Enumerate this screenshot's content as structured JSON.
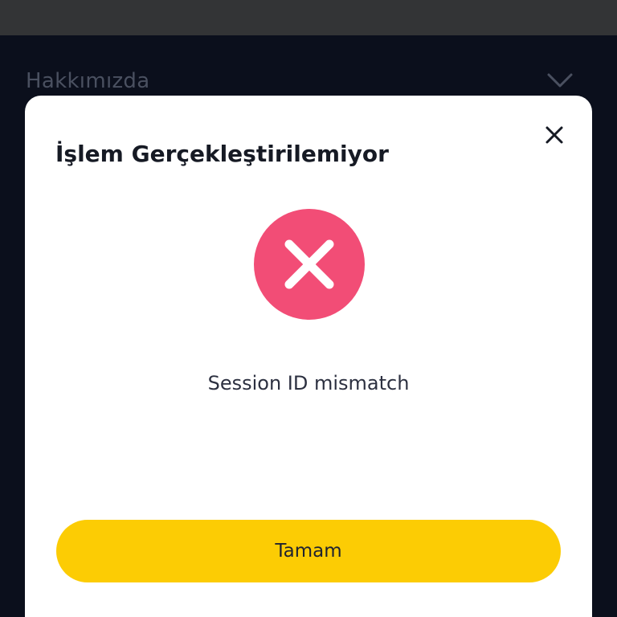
{
  "background": {
    "section_title": "Hakkımızda",
    "chevron_icon": "chevron-down-icon"
  },
  "modal": {
    "title": "İşlem Gerçekleştirilemiyor",
    "close_icon": "close-icon",
    "status_icon": "error-x-icon",
    "message": "Session ID mismatch",
    "ok_label": "Tamam"
  },
  "colors": {
    "background": "#0b0f1c",
    "status_bar": "#333436",
    "modal": "#ffffff",
    "error": "#f24d76",
    "primary_button": "#fccc04",
    "text_dark": "#161a24"
  }
}
